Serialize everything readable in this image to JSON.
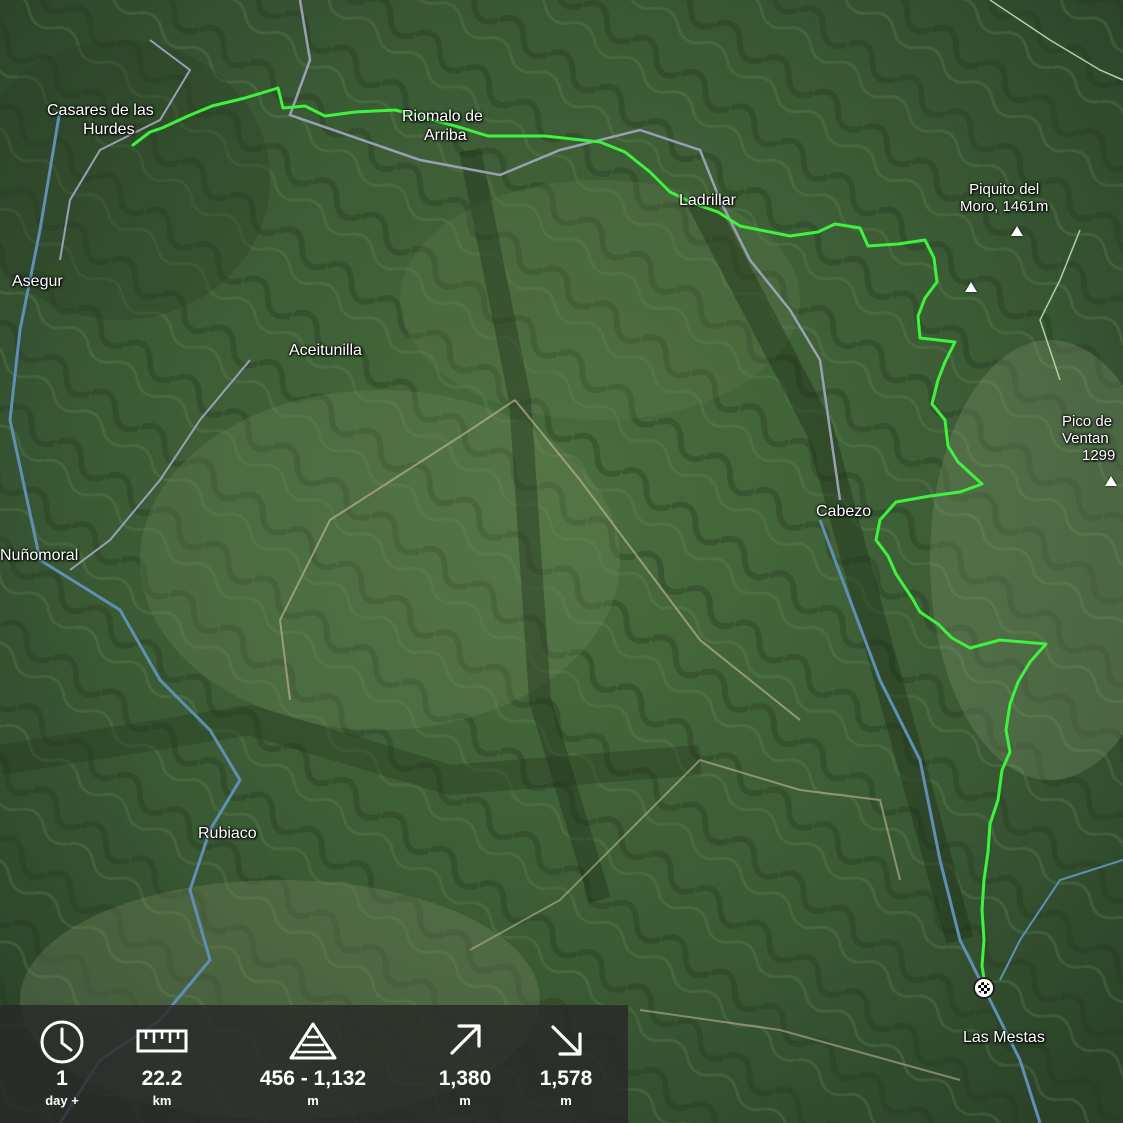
{
  "map": {
    "places": [
      {
        "id": "casares",
        "lines": [
          "Casares de las",
          "Hurdes"
        ]
      },
      {
        "id": "riomalo",
        "lines": [
          "Riomalo de",
          "Arriba"
        ]
      },
      {
        "id": "ladrillar",
        "lines": [
          "Ladrillar"
        ]
      },
      {
        "id": "asegur",
        "lines": [
          "Asegur"
        ]
      },
      {
        "id": "aceitunilla",
        "lines": [
          "Aceitunilla"
        ]
      },
      {
        "id": "cabezo",
        "lines": [
          "Cabezo"
        ]
      },
      {
        "id": "nunomoral",
        "lines": [
          "Nuñomoral"
        ]
      },
      {
        "id": "rubiaco",
        "lines": [
          "Rubiaco"
        ]
      },
      {
        "id": "mestas",
        "lines": [
          "Las Mestas"
        ]
      }
    ],
    "peaks": [
      {
        "id": "piquito",
        "lines": [
          "Piquito del",
          "Moro, 1461m"
        ]
      },
      {
        "id": "ventana",
        "lines": [
          "Pico de",
          "Ventan",
          "1299"
        ]
      }
    ],
    "route_color": "#3ef23e",
    "road_color": "#9aa0b4",
    "river_color": "#5f8fb4"
  },
  "stats": {
    "duration": {
      "value": "1",
      "unit": "day +",
      "icon": "clock-icon"
    },
    "distance": {
      "value": "22.2",
      "unit": "km",
      "icon": "ruler-icon"
    },
    "elevation": {
      "value": "456 - 1,132",
      "unit": "m",
      "icon": "elevation-triangle-icon"
    },
    "ascent": {
      "value": "1,380",
      "unit": "m",
      "icon": "arrow-up-right-icon"
    },
    "descent": {
      "value": "1,578",
      "unit": "m",
      "icon": "arrow-down-right-icon"
    }
  }
}
